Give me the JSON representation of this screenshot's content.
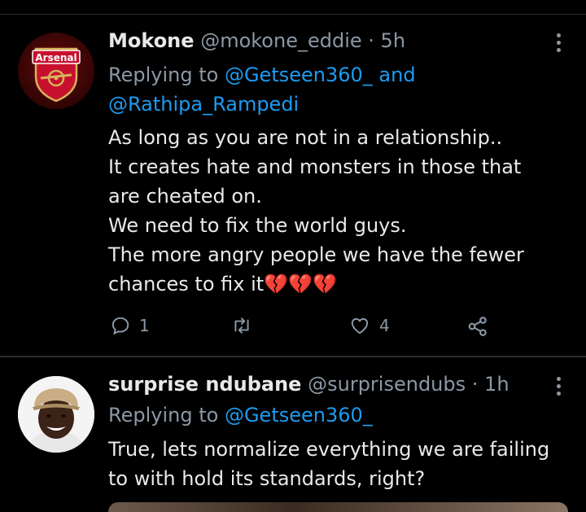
{
  "tweets": [
    {
      "name": "Mokone",
      "handle": "@mokone_eddie",
      "dot": "·",
      "time": "5h",
      "avatar_text": "Arsenal",
      "replying_prefix": "Replying to",
      "mention1": "@Getseen360_",
      "and": "and",
      "mention2": "@Rathipa_Rampedi",
      "lines": [
        "As long as you are not in a relationship..",
        "It creates hate and monsters in those that",
        "are cheated on.",
        "We need to fix the world guys.",
        "The more angry people we have  the fewer",
        "chances to fix it"
      ],
      "emoji": "💔💔💔",
      "reply_count": "1",
      "like_count": "4"
    },
    {
      "name": "surprise ndubane",
      "handle": "@surprisendubs",
      "dot": "·",
      "time": "1h",
      "replying_prefix": "Replying to",
      "mention1": "@Getseen360_",
      "lines": [
        "True, lets normalize everything we are failing",
        "to with hold its standards, right?"
      ]
    }
  ],
  "colors": {
    "background": "#000000",
    "text": "#e7e9ea",
    "muted": "#8b98a5",
    "link": "#1d9bf0",
    "divider": "#2a2e33",
    "heart": "#f91880"
  },
  "icons": [
    "more-icon",
    "reply-icon",
    "retweet-icon",
    "like-icon",
    "share-icon"
  ]
}
